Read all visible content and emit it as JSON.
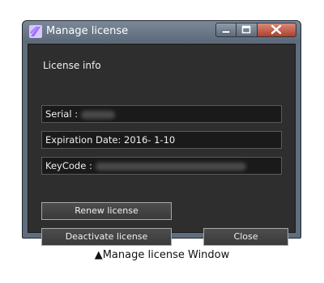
{
  "window": {
    "title": "Manage license",
    "icon": "app-logo-icon"
  },
  "license_info": {
    "heading": "License info",
    "serial_label": "Serial :",
    "expiration_label": "Expiration Date: 2016- 1-10",
    "keycode_label": "KeyCode :"
  },
  "buttons": {
    "renew": "Renew license",
    "deactivate": "Deactivate license",
    "close": "Close"
  },
  "caption": "▲Manage license Window",
  "colors": {
    "client_bg": "#2e2e2e",
    "field_bg": "#1a1a1a",
    "title_bar": "#6b7889"
  }
}
